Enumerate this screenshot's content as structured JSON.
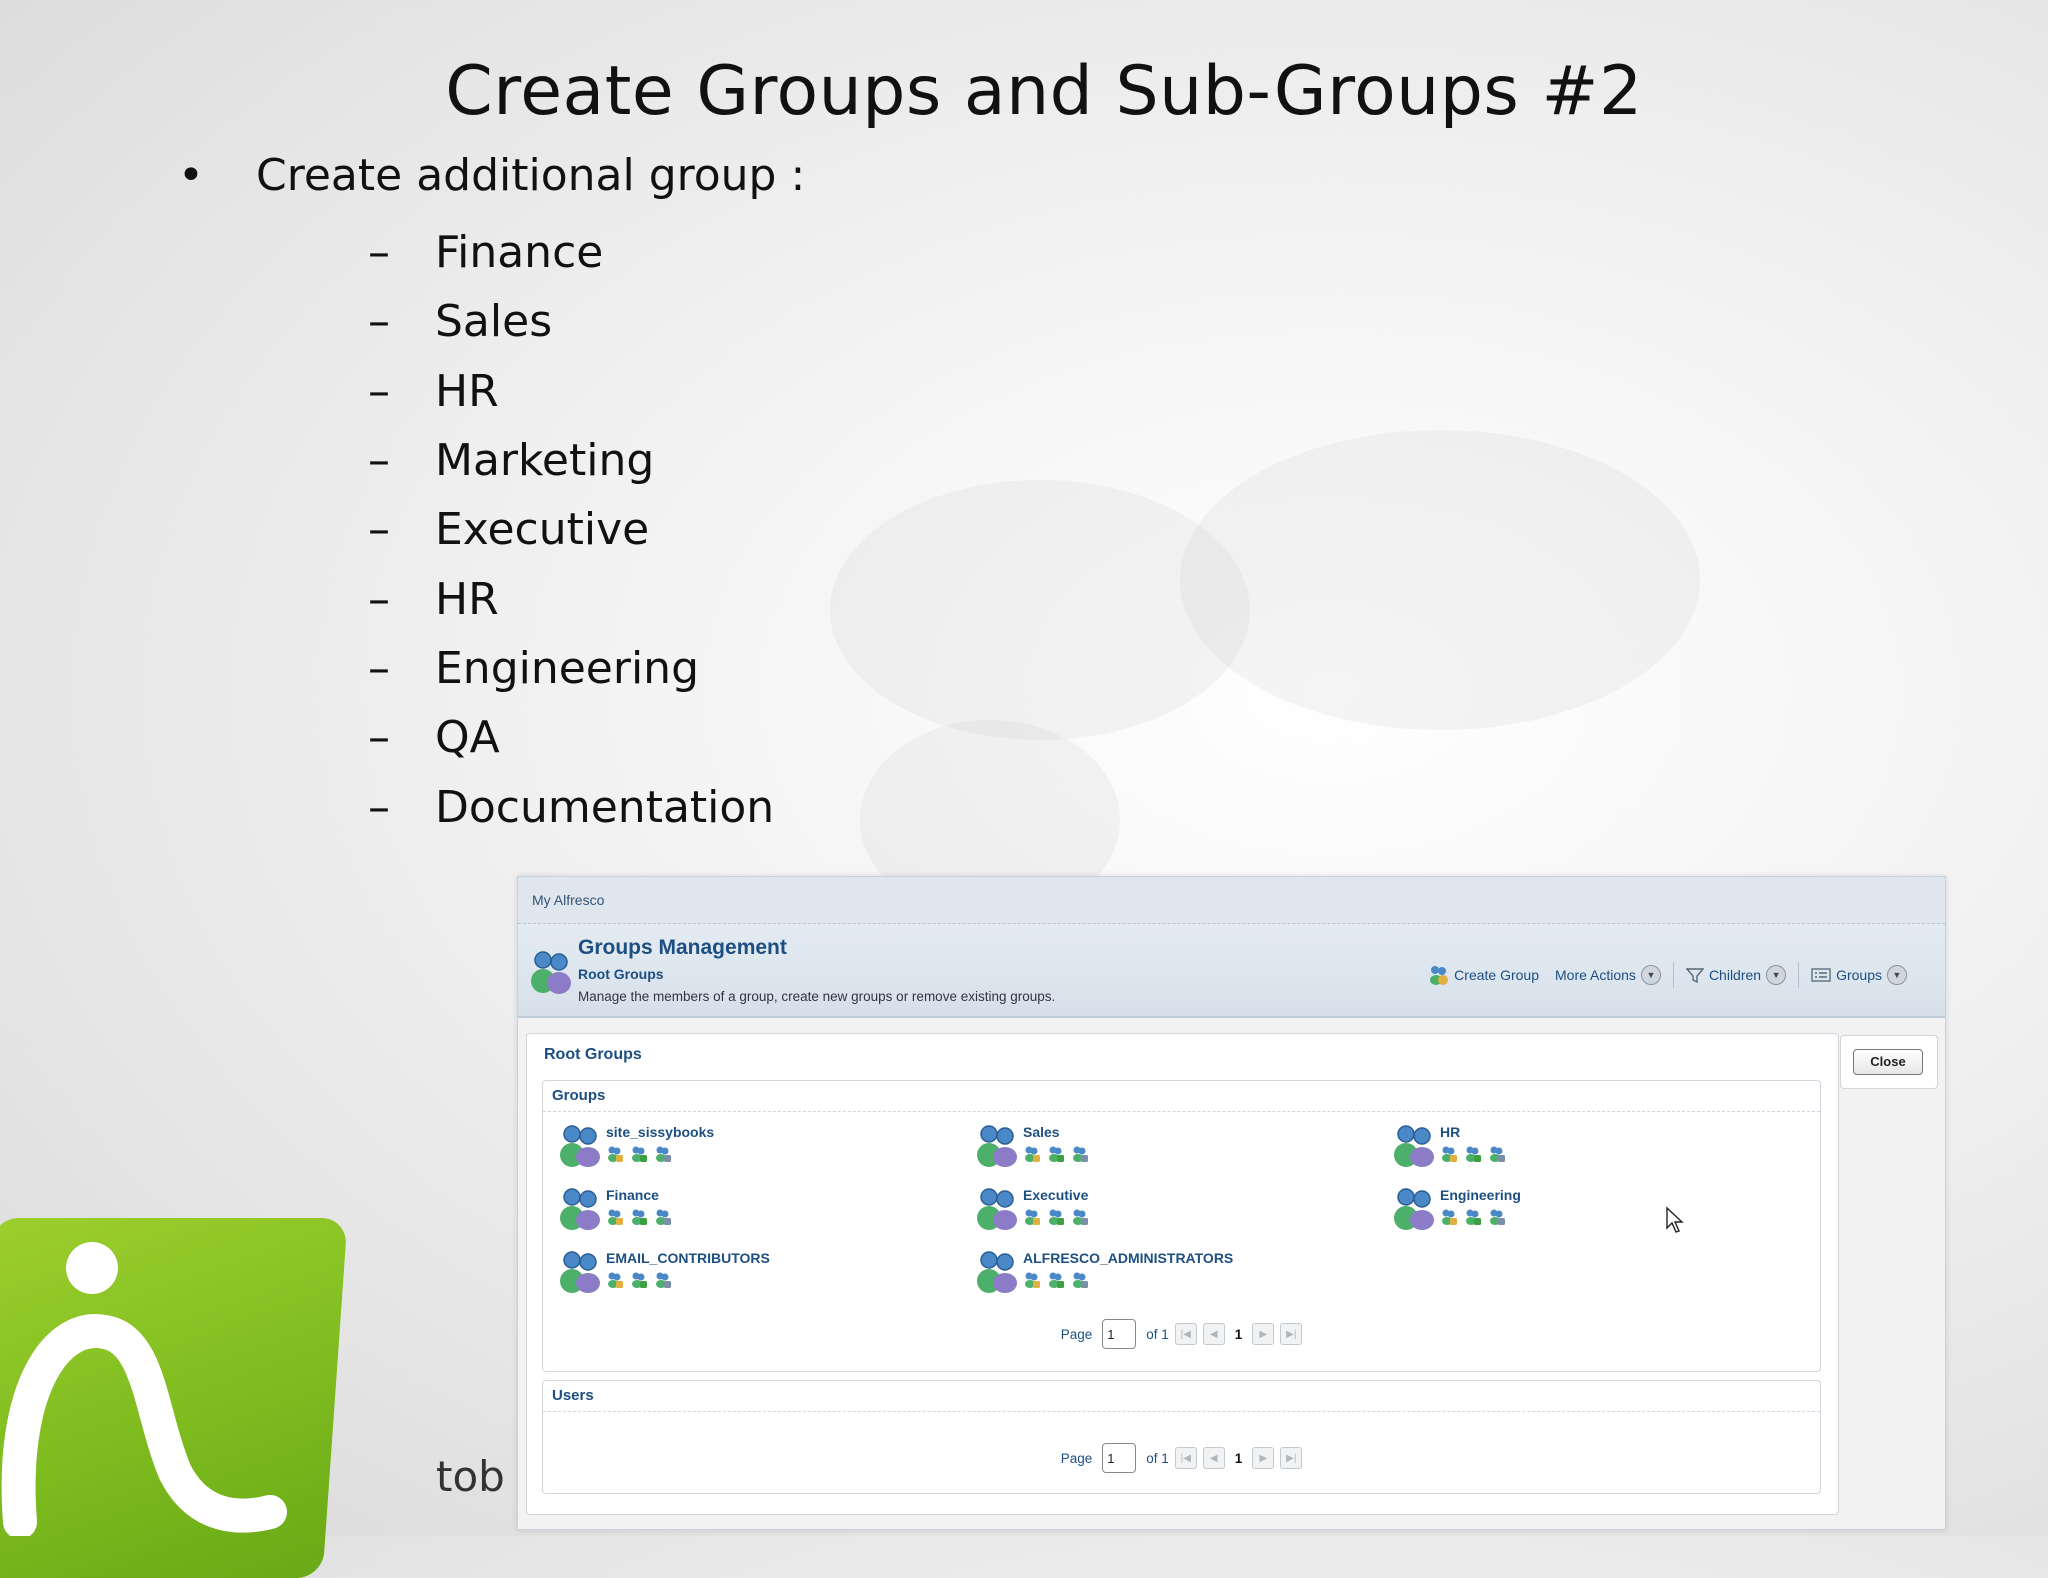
{
  "slide": {
    "title": "Create Groups and Sub-Groups #2",
    "bullet": "Create additional group :",
    "sub_items": [
      "Finance",
      "Sales",
      "HR",
      "Marketing",
      "Executive",
      "HR",
      "Engineering",
      "QA",
      "Documentation"
    ],
    "logo_text": "tob"
  },
  "app": {
    "nav_link": "My Alfresco",
    "header": {
      "title": "Groups Management",
      "subtitle": "Root Groups",
      "description": "Manage the members of a group, create new groups or remove existing groups."
    },
    "toolbar": {
      "create_group": "Create Group",
      "more_actions": "More Actions",
      "children": "Children",
      "groups": "Groups"
    },
    "panel_title": "Root Groups",
    "close_label": "Close",
    "groups_section": {
      "title": "Groups",
      "items": [
        "site_sissybooks",
        "Sales",
        "HR",
        "Finance",
        "Executive",
        "Engineering",
        "EMAIL_CONTRIBUTORS",
        "ALFRESCO_ADMINISTRATORS"
      ],
      "pager": {
        "page_label": "Page",
        "page_value": "1",
        "of_label": "of 1",
        "current": "1"
      }
    },
    "users_section": {
      "title": "Users",
      "pager": {
        "page_label": "Page",
        "page_value": "1",
        "of_label": "of 1",
        "current": "1"
      }
    }
  },
  "colors": {
    "accent": "#1d4f82",
    "logo_green": "#7fbc1f"
  }
}
